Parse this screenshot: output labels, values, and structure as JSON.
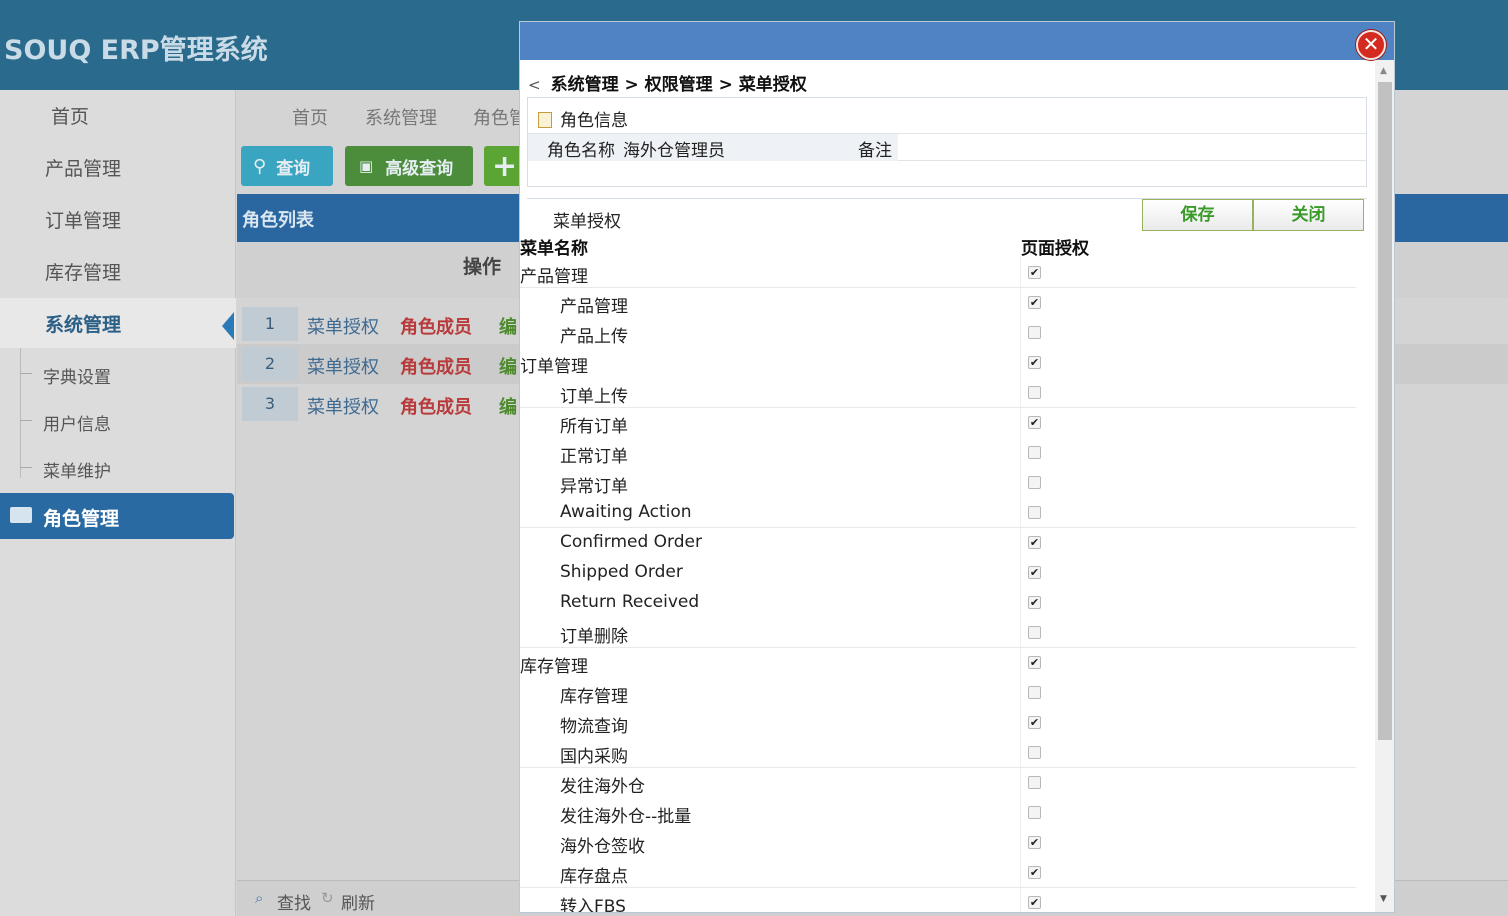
{
  "app": {
    "title": "SOUQ ERP管理系统"
  },
  "sidebar": {
    "items": [
      {
        "label": "首页"
      },
      {
        "label": "产品管理"
      },
      {
        "label": "订单管理"
      },
      {
        "label": "库存管理"
      },
      {
        "label": "系统管理"
      }
    ],
    "subitems": [
      {
        "label": "字典设置"
      },
      {
        "label": "用户信息"
      },
      {
        "label": "菜单维护"
      },
      {
        "label": "角色管理"
      }
    ]
  },
  "main": {
    "tabs": [
      "首页",
      "系统管理",
      "角色管"
    ],
    "buttons": {
      "query": "查询",
      "advanced": "高级查询",
      "add": "+"
    },
    "list_title": "角色列表",
    "ops_header": "操作",
    "rows": [
      {
        "num": "1",
        "a1": "菜单授权",
        "a2": "角色成员",
        "a3": "编"
      },
      {
        "num": "2",
        "a1": "菜单授权",
        "a2": "角色成员",
        "a3": "编"
      },
      {
        "num": "3",
        "a1": "菜单授权",
        "a2": "角色成员",
        "a3": "编"
      }
    ],
    "footer": {
      "find": "查找",
      "refresh": "刷新"
    }
  },
  "modal": {
    "breadcrumb": "系统管理 > 权限管理 > 菜单授权",
    "back_glyph": "<",
    "close_glyph": "✕",
    "role_info_title": "角色信息",
    "role_name_label": "角色名称",
    "role_name_value": "海外仓管理员",
    "remark_label": "备注",
    "menu_auth_title": "菜单授权",
    "save_label": "保存",
    "close_label": "关闭",
    "col_menu": "菜单名称",
    "col_auth": "页面授权",
    "rows": [
      {
        "name": "产品管理",
        "level": 0,
        "checked": true,
        "line": true
      },
      {
        "name": "产品管理",
        "level": 1,
        "checked": true,
        "line": false
      },
      {
        "name": "产品上传",
        "level": 1,
        "checked": false,
        "line": false
      },
      {
        "name": "订单管理",
        "level": 0,
        "checked": true,
        "line": false
      },
      {
        "name": "订单上传",
        "level": 1,
        "checked": false,
        "line": true
      },
      {
        "name": "所有订单",
        "level": 1,
        "checked": true,
        "line": false
      },
      {
        "name": "正常订单",
        "level": 1,
        "checked": false,
        "line": false
      },
      {
        "name": "异常订单",
        "level": 1,
        "checked": false,
        "line": false
      },
      {
        "name": "Awaiting Action",
        "level": 1,
        "checked": false,
        "line": true
      },
      {
        "name": "Confirmed Order",
        "level": 1,
        "checked": true,
        "line": false
      },
      {
        "name": "Shipped Order",
        "level": 1,
        "checked": true,
        "line": false
      },
      {
        "name": "Return Received",
        "level": 1,
        "checked": true,
        "line": false
      },
      {
        "name": "订单删除",
        "level": 1,
        "checked": false,
        "line": true
      },
      {
        "name": "库存管理",
        "level": 0,
        "checked": true,
        "line": false
      },
      {
        "name": "库存管理",
        "level": 1,
        "checked": false,
        "line": false
      },
      {
        "name": "物流查询",
        "level": 1,
        "checked": true,
        "line": false
      },
      {
        "name": "国内采购",
        "level": 1,
        "checked": false,
        "line": true
      },
      {
        "name": "发往海外仓",
        "level": 1,
        "checked": false,
        "line": false
      },
      {
        "name": "发往海外仓--批量",
        "level": 1,
        "checked": false,
        "line": false
      },
      {
        "name": "海外仓签收",
        "level": 1,
        "checked": true,
        "line": false
      },
      {
        "name": "库存盘点",
        "level": 1,
        "checked": true,
        "line": true
      },
      {
        "name": "转入FBS",
        "level": 1,
        "checked": true,
        "line": false
      }
    ]
  },
  "colors": {
    "header": "#2a6a8c",
    "modal_header": "#5083c4",
    "accent": "#2a6aa3",
    "close": "#d42a1f"
  }
}
